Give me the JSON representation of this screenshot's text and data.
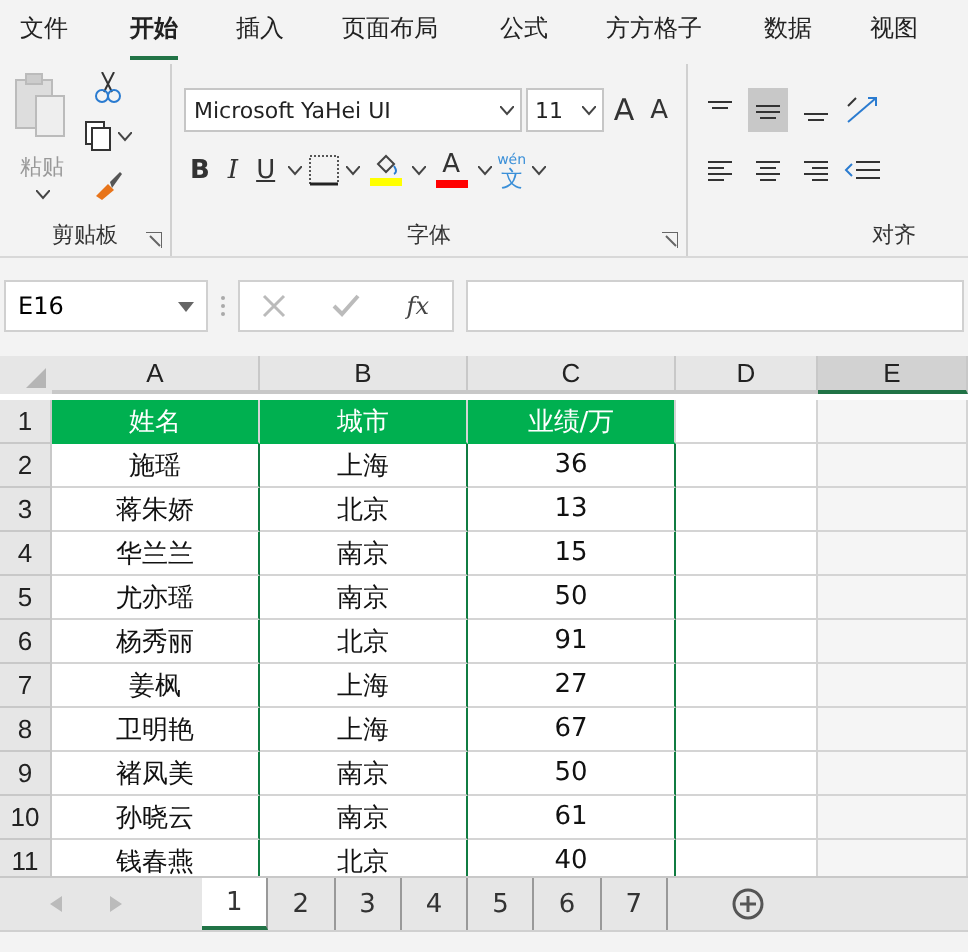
{
  "menu_tabs": [
    {
      "label": "文件",
      "selected": false
    },
    {
      "label": "开始",
      "selected": true
    },
    {
      "label": "插入",
      "selected": false
    },
    {
      "label": "页面布局",
      "selected": false
    },
    {
      "label": "公式",
      "selected": false
    },
    {
      "label": "方方格子",
      "selected": false
    },
    {
      "label": "数据",
      "selected": false
    },
    {
      "label": "视图",
      "selected": false
    }
  ],
  "ribbon": {
    "clipboard": {
      "paste_label": "粘贴",
      "group_label": "剪贴板"
    },
    "font": {
      "font_name": "Microsoft YaHei UI",
      "font_size": "11",
      "grow": "A",
      "shrink": "A",
      "bold": "B",
      "italic": "I",
      "underline": "U",
      "font_color": "A",
      "phonetic_top": "wén",
      "phonetic_bottom": "文",
      "group_label": "字体"
    },
    "alignment": {
      "group_label": "对齐"
    }
  },
  "formula_bar": {
    "name_box": "E16",
    "fx": "fx"
  },
  "columns": [
    {
      "label": "A",
      "selected": false
    },
    {
      "label": "B",
      "selected": false
    },
    {
      "label": "C",
      "selected": false
    },
    {
      "label": "D",
      "selected": false
    },
    {
      "label": "E",
      "selected": true
    }
  ],
  "rows": [
    {
      "number": "1",
      "header": true,
      "cells": [
        "姓名",
        "城市",
        "业绩/万"
      ]
    },
    {
      "number": "2",
      "header": false,
      "cells": [
        "施瑶",
        "上海",
        "36"
      ]
    },
    {
      "number": "3",
      "header": false,
      "cells": [
        "蒋朱娇",
        "北京",
        "13"
      ]
    },
    {
      "number": "4",
      "header": false,
      "cells": [
        "华兰兰",
        "南京",
        "15"
      ]
    },
    {
      "number": "5",
      "header": false,
      "cells": [
        "尤亦瑶",
        "南京",
        "50"
      ]
    },
    {
      "number": "6",
      "header": false,
      "cells": [
        "杨秀丽",
        "北京",
        "91"
      ]
    },
    {
      "number": "7",
      "header": false,
      "cells": [
        "姜枫",
        "上海",
        "27"
      ]
    },
    {
      "number": "8",
      "header": false,
      "cells": [
        "卫明艳",
        "上海",
        "67"
      ]
    },
    {
      "number": "9",
      "header": false,
      "cells": [
        "褚凤美",
        "南京",
        "50"
      ]
    },
    {
      "number": "10",
      "header": false,
      "cells": [
        "孙晓云",
        "南京",
        "61"
      ]
    },
    {
      "number": "11",
      "header": false,
      "cells": [
        "钱春燕",
        "北京",
        "40"
      ]
    }
  ],
  "sheet_tabs": [
    {
      "label": "1",
      "selected": true
    },
    {
      "label": "2",
      "selected": false
    },
    {
      "label": "3",
      "selected": false
    },
    {
      "label": "4",
      "selected": false
    },
    {
      "label": "5",
      "selected": false
    },
    {
      "label": "6",
      "selected": false
    },
    {
      "label": "7",
      "selected": false
    }
  ]
}
